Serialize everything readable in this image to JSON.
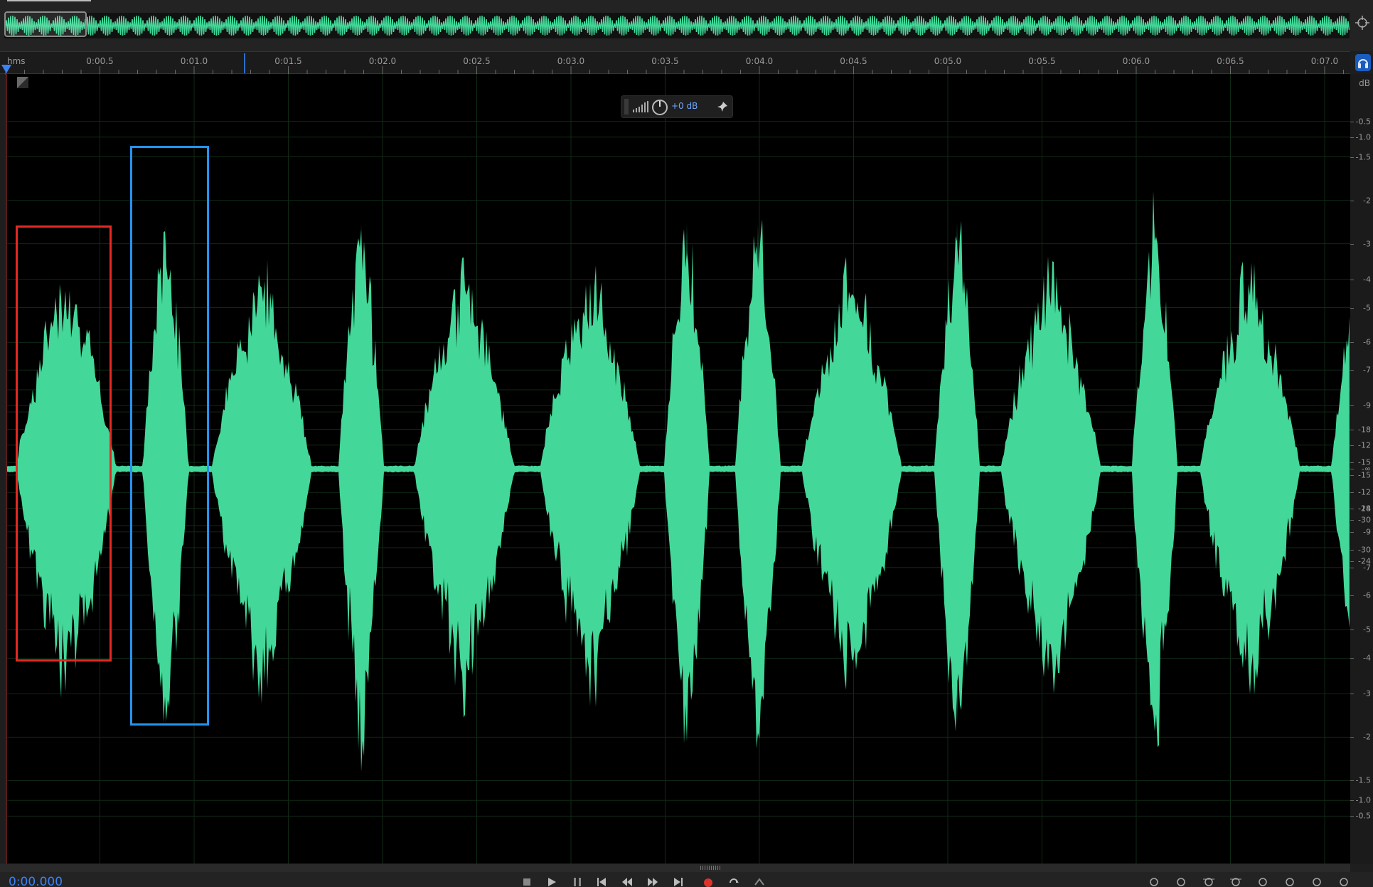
{
  "ruler": {
    "unit": "hms",
    "ticks": [
      "0:00.5",
      "0:01.0",
      "0:01.5",
      "0:02.0",
      "0:02.5",
      "0:03.0",
      "0:03.5",
      "0:04.0",
      "0:04.5",
      "0:05.0",
      "0:05.5",
      "0:06.0",
      "0:06.5",
      "0:07.0"
    ]
  },
  "hud": {
    "gain": "+0 dB"
  },
  "db_scale": {
    "unit": "dB",
    "labels": [
      "-0.5",
      "-1.0",
      "-1.5",
      "-2",
      "-3",
      "-4",
      "-5",
      "-6",
      "-7",
      "-9",
      "-12",
      "-15",
      "-18",
      "-24",
      "-30",
      "-∞",
      "-30",
      "-24",
      "-18",
      "-15",
      "-12",
      "-9",
      "-7",
      "-6",
      "-5",
      "-4",
      "-3",
      "-2",
      "-1.5",
      "-1.0",
      "-0.5"
    ]
  },
  "transport": {
    "time": "0:00.000"
  },
  "colors": {
    "waveform": "#43d899",
    "annotation_red": "#e32a22",
    "annotation_blue": "#2593f0",
    "accent": "#3b82f6"
  },
  "icons": {
    "zoom": "crosshair-zoom-icon",
    "monitor": "headphones-icon",
    "fade": "fade-handle-icon",
    "hud_pin": "pin-icon"
  }
}
